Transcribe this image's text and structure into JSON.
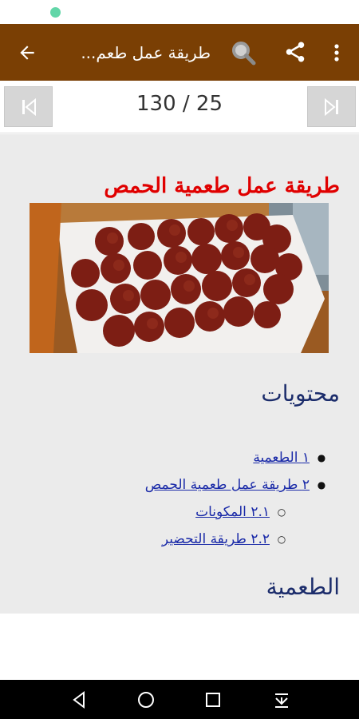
{
  "app_bar": {
    "title": "طريقة عمل طعم...",
    "back_icon": "arrow-back-icon",
    "search_icon": "search-icon",
    "share_icon": "share-icon",
    "more_icon": "more-vert-icon",
    "color": "#7a3f04"
  },
  "pager": {
    "counter": "130 / 25",
    "first_icon": "skip-first-icon",
    "last_icon": "skip-last-icon"
  },
  "article": {
    "title": "طريقة عمل طعمية الحمص",
    "title_color": "#e00000",
    "image": "falafel-balls-photo",
    "toc_heading": "محتويات",
    "toc": [
      {
        "label": "١ الطعمية",
        "level": 1
      },
      {
        "label": "٢ طريقة عمل طعمية الحمص",
        "level": 1
      },
      {
        "label": "٢.١ المكونات",
        "level": 2
      },
      {
        "label": "٢.٢ طريقة التحضير",
        "level": 2
      }
    ],
    "section_heading": "الطعمية"
  },
  "system_nav": {
    "back_icon": "nav-back-icon",
    "home_icon": "nav-home-icon",
    "recents_icon": "nav-recents-icon",
    "hide_icon": "nav-hide-icon"
  }
}
